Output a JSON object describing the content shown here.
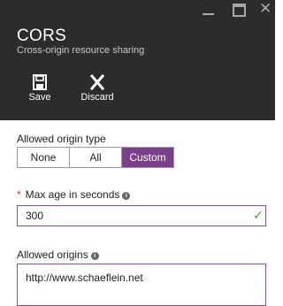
{
  "blade": {
    "title": "CORS",
    "subtitle": "Cross-origin resource sharing"
  },
  "commands": {
    "save_label": "Save",
    "discard_label": "Discard"
  },
  "allowed_origin_type": {
    "label": "Allowed origin type",
    "options": [
      "None",
      "All",
      "Custom"
    ],
    "selected": "Custom"
  },
  "max_age": {
    "required_marker": "*",
    "label": "Max age in seconds",
    "value": "300"
  },
  "allowed_origins": {
    "label": "Allowed origins",
    "value": "http://www.schaeflein.net"
  },
  "colors": {
    "header_bg": "#2c2c2c",
    "accent": "#7b3f8c",
    "required": "#d13438",
    "valid": "#4aa24a"
  }
}
